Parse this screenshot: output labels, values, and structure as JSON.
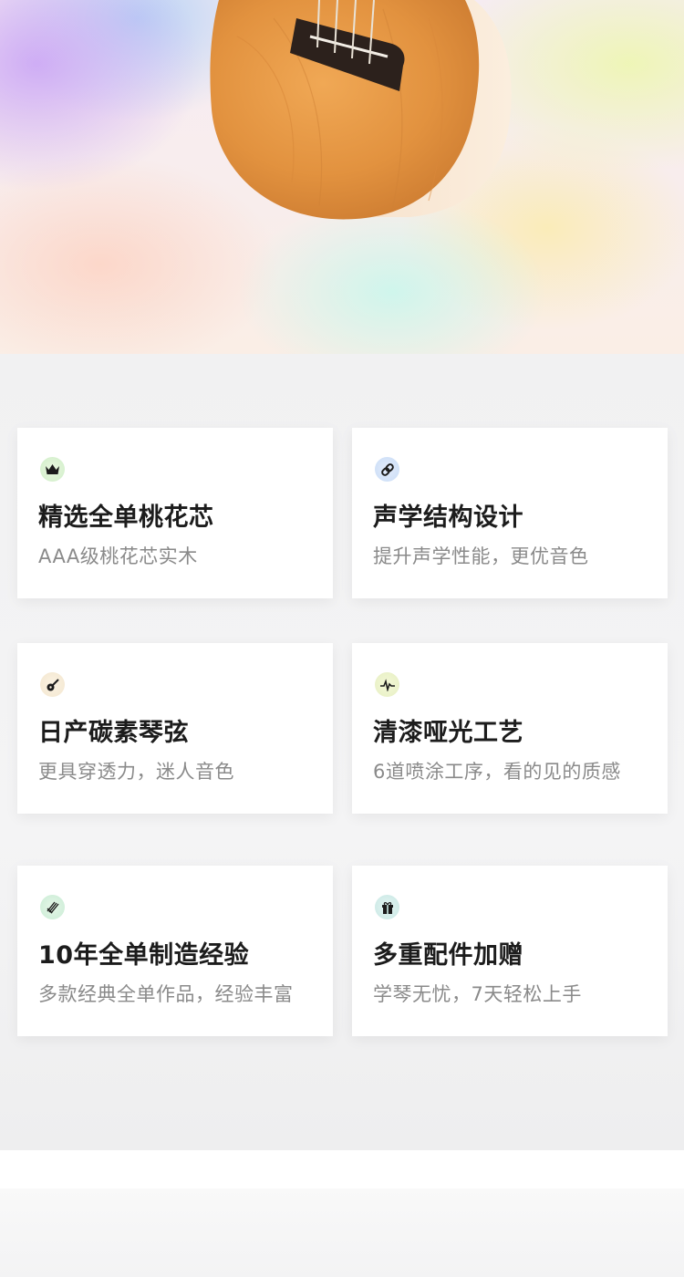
{
  "colors": {
    "card_background": "#ffffff",
    "title_color": "#1c1c1c",
    "description_color": "#8a8a8a",
    "page_background": "#f3f3f4"
  },
  "features": [
    {
      "icon": "crown-icon",
      "title": "精选全单桃花芯",
      "desc": "AAA级桃花芯实木"
    },
    {
      "icon": "link-icon",
      "title": "声学结构设计",
      "desc": "提升声学性能，更优音色"
    },
    {
      "icon": "guitar-icon",
      "title": "日产碳素琴弦",
      "desc": "更具穿透力，迷人音色"
    },
    {
      "icon": "waveform-icon",
      "title": "清漆哑光工艺",
      "desc": "6道喷涂工序，看的见的质感"
    },
    {
      "icon": "strings-icon",
      "title": "10年全单制造经验",
      "desc": "多款经典全单作品，经验丰富"
    },
    {
      "icon": "gift-icon",
      "title": "多重配件加赠",
      "desc": "学琴无忧，7天轻松上手"
    }
  ]
}
